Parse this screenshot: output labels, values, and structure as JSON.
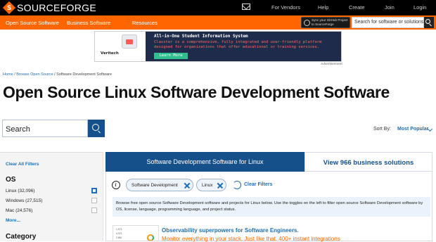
{
  "header": {
    "logo_text": "SOURCEFORGE",
    "logo_glyph": "S",
    "mail_icon": "mail-icon",
    "nav": [
      "For Vendors",
      "Help",
      "Create",
      "Join",
      "Login"
    ]
  },
  "subnav": {
    "links": [
      "Open Source Software",
      "Business Software",
      "Resources"
    ],
    "github_sync": "Sync your GitHub Project to SourceForge",
    "search_placeholder": "Search for software or solutions"
  },
  "ad": {
    "brand": "Veritech",
    "title": "All-in-One Student Information System",
    "description": "Classter is a comprehensive, fully integrated and user-friendly platform designed for organizations that offer educational or training services.",
    "button": "Learn More",
    "label": "Advertisement"
  },
  "breadcrumb": {
    "home": "Home",
    "browse": "Browse Open Source",
    "current": "Software Development Software",
    "separator": "/"
  },
  "page": {
    "title": "Open Source Linux Software Development Software"
  },
  "search": {
    "placeholder": "Search"
  },
  "sort": {
    "label": "Sort By:",
    "value": "Most Popular"
  },
  "sidebar": {
    "clear_all": "Clear All Filters",
    "os_heading": "OS",
    "os_filters": [
      {
        "label": "Linux (32,096)",
        "checked": true
      },
      {
        "label": "Windows (27,515)",
        "checked": false
      },
      {
        "label": "Mac (24,576)",
        "checked": false
      }
    ],
    "more": "More...",
    "category_heading": "Category"
  },
  "tabs": {
    "active": "Software Development Software for Linux",
    "business": "View 966 business solutions"
  },
  "filters": {
    "chips": [
      "Software Development",
      "Linux"
    ],
    "clear": "Clear Filters"
  },
  "description": "Browse free open source Software Development software and projects for Linux below. Use the toggles on the left to filter open source Software Development software by OS, license, language, programming language, and project status.",
  "result": {
    "title": "Observability superpowers for Software Engineers.",
    "tagline": "Monitor everything in your stack. Just like that. 400+ instant integrations",
    "thumb_values": [
      "1,071",
      "4,371",
      "2.8M"
    ]
  },
  "colors": {
    "brand_orange": "#ff6600",
    "nav_blue": "#15508b",
    "link_blue": "#1f6fb4"
  }
}
